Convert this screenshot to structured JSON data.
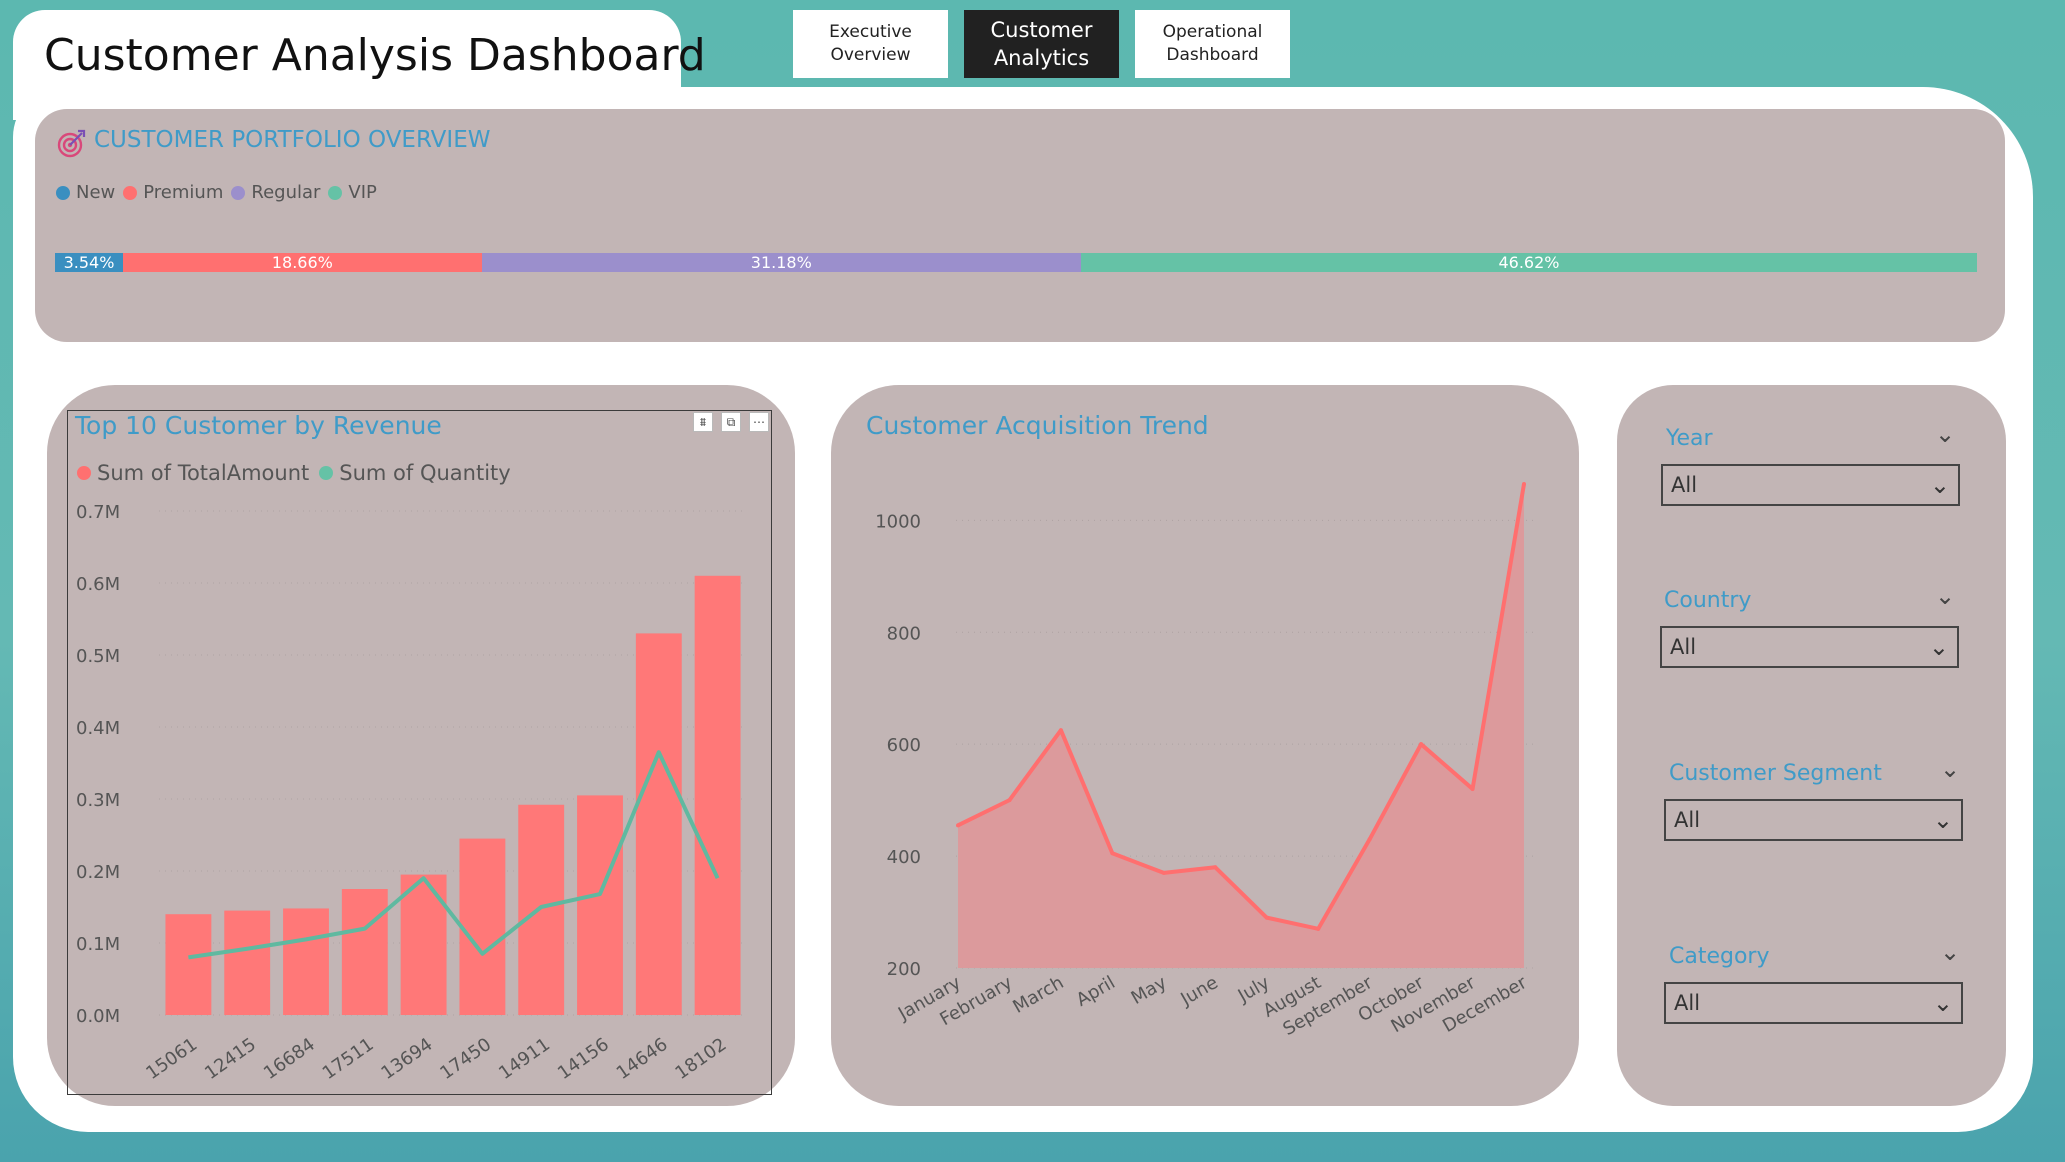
{
  "header": {
    "title": "Customer Analysis Dashboard",
    "nav": [
      {
        "label": "Executive Overview",
        "active": false
      },
      {
        "label": "Customer Analytics",
        "active": true
      },
      {
        "label": "Operational Dashboard",
        "active": false
      }
    ]
  },
  "colors": {
    "accent_title": "#3f9bc8",
    "panel_bg": "#c2b5b5",
    "new": "#3a8fc0",
    "premium": "#ff7070",
    "regular": "#9b8fcc",
    "vip": "#65c2a6",
    "line_quantity": "#5fb9a0"
  },
  "portfolio": {
    "icon": "target-icon",
    "title": "CUSTOMER PORTFOLIO OVERVIEW",
    "legend": [
      "New",
      "Premium",
      "Regular",
      "VIP"
    ],
    "segments": [
      {
        "name": "New",
        "percent": 3.54,
        "label": "3.54%"
      },
      {
        "name": "Premium",
        "percent": 18.66,
        "label": "18.66%"
      },
      {
        "name": "Regular",
        "percent": 31.18,
        "label": "31.18%"
      },
      {
        "name": "VIP",
        "percent": 46.62,
        "label": "46.62%"
      }
    ]
  },
  "top10": {
    "title": "Top 10 Customer by Revenue",
    "legend": [
      "Sum of TotalAmount",
      "Sum of Quantity"
    ],
    "header_icons": [
      "filter-icon",
      "focus-mode-icon",
      "more-options-icon"
    ],
    "header_glyphs": [
      "⩩",
      "⧉",
      "⋯"
    ]
  },
  "trend": {
    "title": "Customer Acquisition Trend"
  },
  "filters": {
    "chevron": "⌄",
    "items": [
      {
        "label": "Year",
        "value": "All"
      },
      {
        "label": "Country",
        "value": "All"
      },
      {
        "label": "Customer Segment",
        "value": "All"
      },
      {
        "label": "Category",
        "value": "All"
      }
    ]
  },
  "chart_data": [
    {
      "type": "bar",
      "title": "Top 10 Customer by Revenue",
      "categories": [
        "15061",
        "12415",
        "16684",
        "17511",
        "13694",
        "17450",
        "14911",
        "14156",
        "14646",
        "18102"
      ],
      "series": [
        {
          "name": "Sum of TotalAmount",
          "type": "bar",
          "values": [
            0.14,
            0.145,
            0.148,
            0.175,
            0.195,
            0.245,
            0.292,
            0.305,
            0.53,
            0.61
          ]
        },
        {
          "name": "Sum of Quantity",
          "type": "line",
          "values": [
            0.08,
            0.092,
            0.105,
            0.12,
            0.19,
            0.085,
            0.15,
            0.168,
            0.365,
            0.19
          ]
        }
      ],
      "yticks": [
        "0.0M",
        "0.1M",
        "0.2M",
        "0.3M",
        "0.4M",
        "0.5M",
        "0.6M",
        "0.7M"
      ],
      "ylim": [
        0,
        0.7
      ],
      "yunit": "M",
      "grid": true,
      "legend_position": "top-left"
    },
    {
      "type": "area",
      "title": "Customer Acquisition Trend",
      "categories": [
        "January",
        "February",
        "March",
        "April",
        "May",
        "June",
        "July",
        "August",
        "September",
        "October",
        "November",
        "December"
      ],
      "values": [
        455,
        500,
        625,
        405,
        370,
        380,
        290,
        270,
        430,
        600,
        520,
        1065
      ],
      "yticks": [
        "200",
        "400",
        "600",
        "800",
        "1000"
      ],
      "ylim": [
        200,
        1090
      ],
      "grid": true
    }
  ]
}
